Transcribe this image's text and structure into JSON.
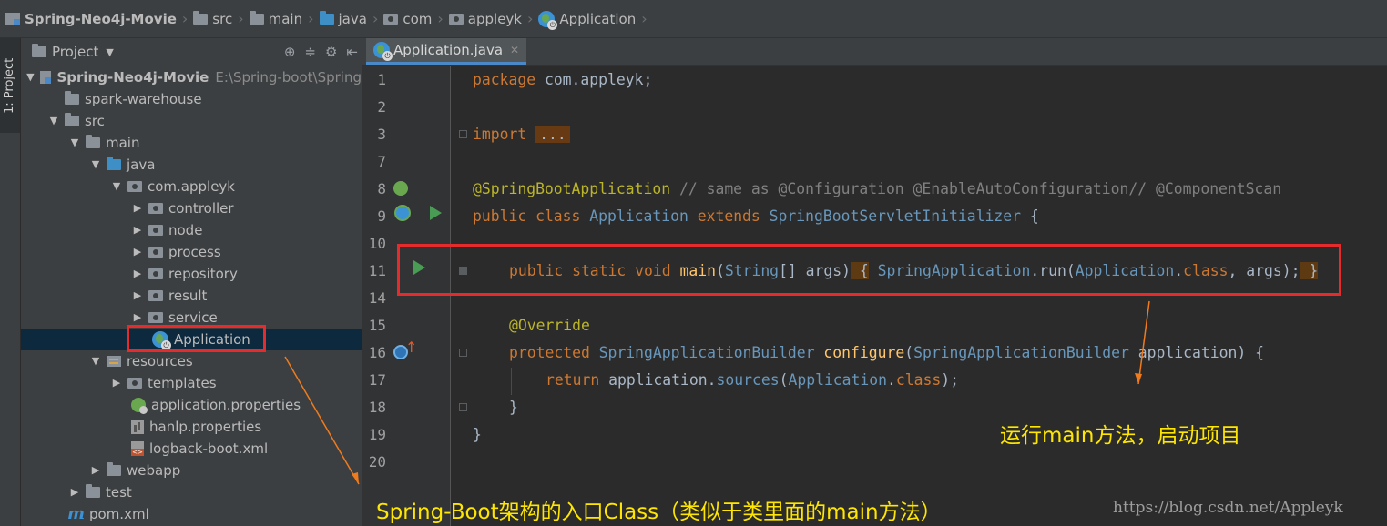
{
  "breadcrumb": {
    "items": [
      {
        "label": "Spring-Neo4j-Movie",
        "icon": "module-icon"
      },
      {
        "label": "src",
        "icon": "folder-icon"
      },
      {
        "label": "main",
        "icon": "folder-icon"
      },
      {
        "label": "java",
        "icon": "source-folder-icon"
      },
      {
        "label": "com",
        "icon": "package-icon"
      },
      {
        "label": "appleyk",
        "icon": "package-icon"
      },
      {
        "label": "Application",
        "icon": "spring-class-icon"
      }
    ]
  },
  "side_tab": {
    "label": "1: Project"
  },
  "project_panel": {
    "title": "Project",
    "tools": [
      "⊕",
      "≑",
      "⚙",
      "⇤"
    ],
    "tree": [
      {
        "label": "Spring-Neo4j-Movie",
        "path": "E:\\Spring-boot\\Spring",
        "icon": "module-icon"
      },
      {
        "label": "spark-warehouse",
        "icon": "folder-icon"
      },
      {
        "label": "src",
        "icon": "folder-icon"
      },
      {
        "label": "main",
        "icon": "folder-icon"
      },
      {
        "label": "java",
        "icon": "source-folder-icon"
      },
      {
        "label": "com.appleyk",
        "icon": "package-icon"
      },
      {
        "label": "controller",
        "icon": "package-icon"
      },
      {
        "label": "node",
        "icon": "package-icon"
      },
      {
        "label": "process",
        "icon": "package-icon"
      },
      {
        "label": "repository",
        "icon": "package-icon"
      },
      {
        "label": "result",
        "icon": "package-icon"
      },
      {
        "label": "service",
        "icon": "package-icon"
      },
      {
        "label": "Application",
        "icon": "spring-class-icon"
      },
      {
        "label": "resources",
        "icon": "resources-folder-icon"
      },
      {
        "label": "templates",
        "icon": "package-icon"
      },
      {
        "label": "application.properties",
        "icon": "spring-properties-icon"
      },
      {
        "label": "hanlp.properties",
        "icon": "properties-file-icon"
      },
      {
        "label": "logback-boot.xml",
        "icon": "xml-file-icon"
      },
      {
        "label": "webapp",
        "icon": "folder-icon"
      },
      {
        "label": "test",
        "icon": "folder-icon"
      },
      {
        "label": "pom.xml",
        "icon": "maven-icon"
      }
    ]
  },
  "editor": {
    "tab_label": "Application.java",
    "line_numbers": [
      "1",
      "2",
      "3",
      "7",
      "8",
      "9",
      "10",
      "11",
      "14",
      "15",
      "16",
      "17",
      "18",
      "19",
      "20"
    ],
    "code": {
      "l1_kw": "package",
      "l1_rest": " com.appleyk;",
      "l3_kw": "import",
      "l3_fold": "...",
      "l8_an": "@SpringBootApplication",
      "l8_cm": " // same as @Configuration @EnableAutoConfiguration// @ComponentScan",
      "l9_kw": "public class",
      "l9_name": " Application ",
      "l9_kw2": "extends",
      "l9_super": " SpringBootServletInitializer",
      "l9_end": " {",
      "l11_kw": "public static void",
      "l11_main": " main",
      "l11_a": "(",
      "l11_string": "String",
      "l11_b": "[] args)",
      "l11_open": " {",
      "l11_spring": " SpringApplication",
      "l11_c": ".run(",
      "l11_app": "Application",
      "l11_d": ".",
      "l11_class": "class",
      "l11_e": ", args);",
      "l11_close": " }",
      "l15_an": "@Override",
      "l16_kw": "protected",
      "l16_builder": " SpringApplicationBuilder",
      "l16_cfg": " configure",
      "l16_a": "(",
      "l16_builder2": "SpringApplicationBuilder",
      "l16_b": " application) {",
      "l17_kw": "return",
      "l17_a": " application.",
      "l17_src": "sources",
      "l17_b": "(",
      "l17_app": "Application",
      "l17_c": ".",
      "l17_class": "class",
      "l17_d": ");",
      "l18": "}",
      "l19": "}"
    }
  },
  "annotations": {
    "note_main": "运行main方法，启动项目",
    "note_entry": "Spring-Boot架构的入口Class（类似于类里面的main方法）",
    "watermark": "https://blog.csdn.net/Appleyk"
  },
  "colors": {
    "annotation_yellow": "#ffe600",
    "annotation_red": "#e52b2b",
    "arrow_orange": "#f07b1d",
    "keyword": "#cc7832",
    "annotation_code": "#bbb529"
  }
}
